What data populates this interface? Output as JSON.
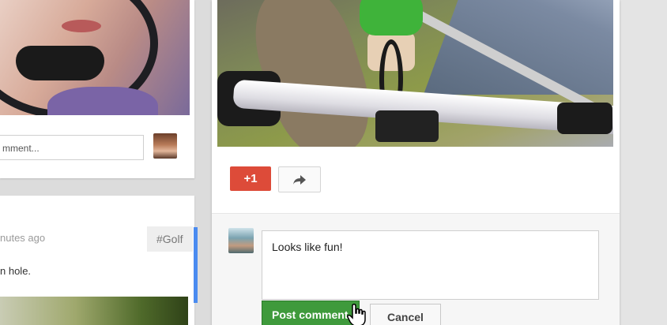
{
  "left_card_top": {
    "comment_placeholder": "mment..."
  },
  "left_card_bottom": {
    "time_text": "nutes ago",
    "hashtag": "#Golf",
    "post_text": "n hole."
  },
  "main_post": {
    "plus_one_label": "+1",
    "share_icon": "share-arrow-icon",
    "comment_value": "Looks like fun!",
    "post_comment_label": "Post comment",
    "cancel_label": "Cancel"
  },
  "colors": {
    "plus_one": "#dd4b39",
    "post_button": "#3f9a3c",
    "accent_blue": "#4a8bf0"
  }
}
